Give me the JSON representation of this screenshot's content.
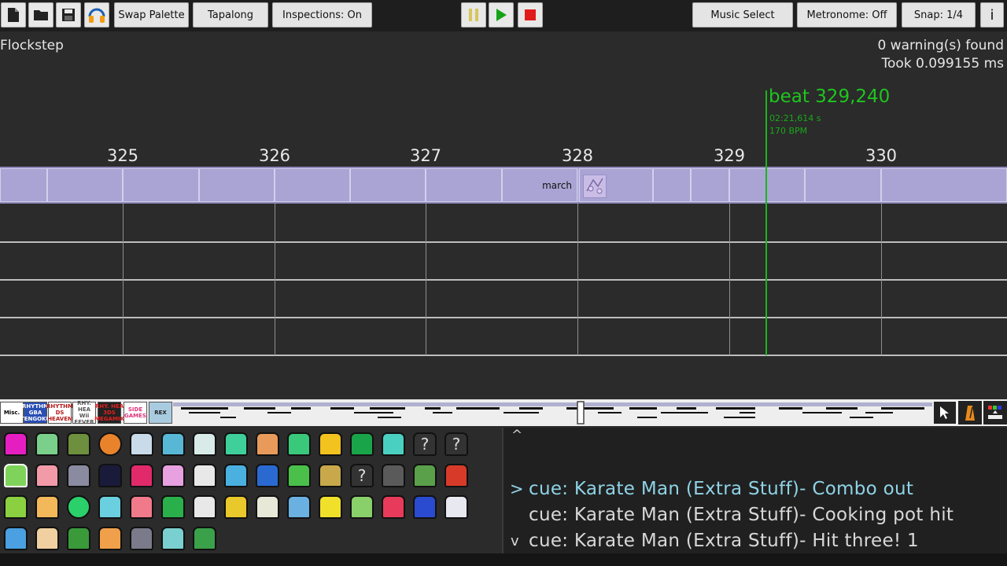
{
  "toolbar": {
    "new_icon": "new-file-icon",
    "open_icon": "folder-icon",
    "save_icon": "save-icon",
    "audio_icon": "headphones-icon",
    "swap_palette": "Swap Palette",
    "tapalong": "Tapalong",
    "inspections": "Inspections: On",
    "music_select": "Music Select",
    "metronome": "Metronome: Off",
    "snap": "Snap: 1/4",
    "info": "i"
  },
  "header": {
    "title": "Flockstep",
    "warnings": "0 warning(s) found",
    "took": "Took 0.099155 ms"
  },
  "timeline": {
    "beat_labels": [
      "325",
      "326",
      "327",
      "328",
      "329",
      "330"
    ],
    "block_label": "march",
    "playhead": {
      "beat": "beat 329,240",
      "time": "02:21,614 s",
      "bpm": "170 BPM"
    }
  },
  "minimap": {
    "consoles": [
      "Misc.",
      "RHYTHM GBA TENGOKU",
      "RHYTHM DS HEAVEN",
      "RHY. HEA Wii FEVER",
      "RHY. HEA 3DS MEGAMIX",
      "SIDE GAMES",
      "REX"
    ]
  },
  "grid": {
    "unknown_glyph": "?"
  },
  "console": {
    "caret_up": "^",
    "caret_down": "v",
    "selected_marker": ">",
    "lines": [
      "cue: Karate Man (Extra Stuff)- Combo out",
      "cue: Karate Man (Extra Stuff)- Cooking pot hit",
      "cue: Karate Man (Extra Stuff)- Hit three! 1"
    ]
  },
  "colors": {
    "playhead": "#1db31d",
    "track_fill": "#b3aedb",
    "selected_line": "#8fd3e6",
    "normal_line": "#d8d8d8"
  }
}
